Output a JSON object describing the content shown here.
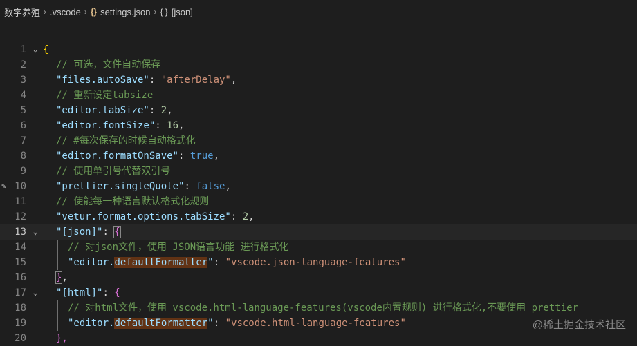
{
  "breadcrumb": {
    "folder": "数字养殖",
    "subfolder": ".vscode",
    "file_icon": "{}",
    "file": "settings.json",
    "symbol_icon": "{ }",
    "symbol": "[json]"
  },
  "editor": {
    "active_line": 13,
    "lines": [
      {
        "n": "1",
        "fold": "⌄",
        "indent": 0,
        "tokens": [
          {
            "t": "{",
            "c": "c-brace"
          }
        ]
      },
      {
        "n": "2",
        "indent": 1,
        "tokens": [
          {
            "t": "// 可选，文件自动保存",
            "c": "c-comment"
          }
        ]
      },
      {
        "n": "3",
        "indent": 1,
        "tokens": [
          {
            "t": "\"files.autoSave\"",
            "c": "c-key"
          },
          {
            "t": ": ",
            "c": "c-punc"
          },
          {
            "t": "\"afterDelay\"",
            "c": "c-str"
          },
          {
            "t": ",",
            "c": "c-punc"
          }
        ]
      },
      {
        "n": "4",
        "indent": 1,
        "tokens": [
          {
            "t": "// 重新设定tabsize",
            "c": "c-comment"
          }
        ]
      },
      {
        "n": "5",
        "indent": 1,
        "tokens": [
          {
            "t": "\"editor.tabSize\"",
            "c": "c-key"
          },
          {
            "t": ": ",
            "c": "c-punc"
          },
          {
            "t": "2",
            "c": "c-num"
          },
          {
            "t": ",",
            "c": "c-punc"
          }
        ]
      },
      {
        "n": "6",
        "indent": 1,
        "tokens": [
          {
            "t": "\"editor.fontSize\"",
            "c": "c-key"
          },
          {
            "t": ": ",
            "c": "c-punc"
          },
          {
            "t": "16",
            "c": "c-num"
          },
          {
            "t": ",",
            "c": "c-punc"
          }
        ]
      },
      {
        "n": "7",
        "indent": 1,
        "tokens": [
          {
            "t": "// #每次保存的时候自动格式化",
            "c": "c-comment"
          }
        ]
      },
      {
        "n": "8",
        "indent": 1,
        "tokens": [
          {
            "t": "\"editor.formatOnSave\"",
            "c": "c-key"
          },
          {
            "t": ": ",
            "c": "c-punc"
          },
          {
            "t": "true",
            "c": "c-bool"
          },
          {
            "t": ",",
            "c": "c-punc"
          }
        ]
      },
      {
        "n": "9",
        "indent": 1,
        "tokens": [
          {
            "t": "// 使用单引号代替双引号",
            "c": "c-comment"
          }
        ]
      },
      {
        "n": "10",
        "indent": 1,
        "edited": true,
        "tokens": [
          {
            "t": "\"prettier.singleQuote\"",
            "c": "c-key"
          },
          {
            "t": ": ",
            "c": "c-punc"
          },
          {
            "t": "false",
            "c": "c-bool"
          },
          {
            "t": ",",
            "c": "c-punc"
          }
        ]
      },
      {
        "n": "11",
        "indent": 1,
        "tokens": [
          {
            "t": "// 使能每一种语言默认格式化规则",
            "c": "c-comment"
          }
        ]
      },
      {
        "n": "12",
        "indent": 1,
        "tokens": [
          {
            "t": "\"vetur.format.options.tabSize\"",
            "c": "c-key"
          },
          {
            "t": ": ",
            "c": "c-punc"
          },
          {
            "t": "2",
            "c": "c-num"
          },
          {
            "t": ",",
            "c": "c-punc"
          }
        ]
      },
      {
        "n": "13",
        "fold": "⌄",
        "indent": 1,
        "tokens": [
          {
            "t": "\"[json]\"",
            "c": "c-key"
          },
          {
            "t": ": ",
            "c": "c-punc"
          },
          {
            "t": "{",
            "c": "c-brace2 bracket-match"
          }
        ]
      },
      {
        "n": "14",
        "indent": 2,
        "tokens": [
          {
            "t": "// 对json文件，使用 JSON语言功能 进行格式化",
            "c": "c-comment"
          }
        ]
      },
      {
        "n": "15",
        "indent": 2,
        "tokens": [
          {
            "t": "\"editor.",
            "c": "c-key"
          },
          {
            "t": "defaultFormatter",
            "c": "c-key hl-word"
          },
          {
            "t": "\"",
            "c": "c-key"
          },
          {
            "t": ": ",
            "c": "c-punc"
          },
          {
            "t": "\"vscode.json-language-features\"",
            "c": "c-str"
          }
        ]
      },
      {
        "n": "16",
        "indent": 1,
        "tokens": [
          {
            "t": "}",
            "c": "c-brace2 bracket-match"
          },
          {
            "t": ",",
            "c": "c-punc"
          }
        ]
      },
      {
        "n": "17",
        "fold": "⌄",
        "indent": 1,
        "tokens": [
          {
            "t": "\"[html]\"",
            "c": "c-key"
          },
          {
            "t": ": ",
            "c": "c-punc"
          },
          {
            "t": "{",
            "c": "c-brace2"
          }
        ]
      },
      {
        "n": "18",
        "indent": 2,
        "tokens": [
          {
            "t": "// 对html文件，使用 vscode.html-language-features(vscode内置规则) 进行格式化,不要使用 prettier",
            "c": "c-comment"
          }
        ]
      },
      {
        "n": "19",
        "indent": 2,
        "tokens": [
          {
            "t": "\"editor.",
            "c": "c-key"
          },
          {
            "t": "defaultFormatter",
            "c": "c-key hl-word"
          },
          {
            "t": "\"",
            "c": "c-key"
          },
          {
            "t": ": ",
            "c": "c-punc"
          },
          {
            "t": "\"vscode.html-language-features\"",
            "c": "c-str"
          }
        ]
      },
      {
        "n": "20",
        "indent": 1,
        "tokens": [
          {
            "t": "},",
            "c": "c-brace2"
          }
        ]
      }
    ]
  },
  "watermark": "@稀土掘金技术社区"
}
